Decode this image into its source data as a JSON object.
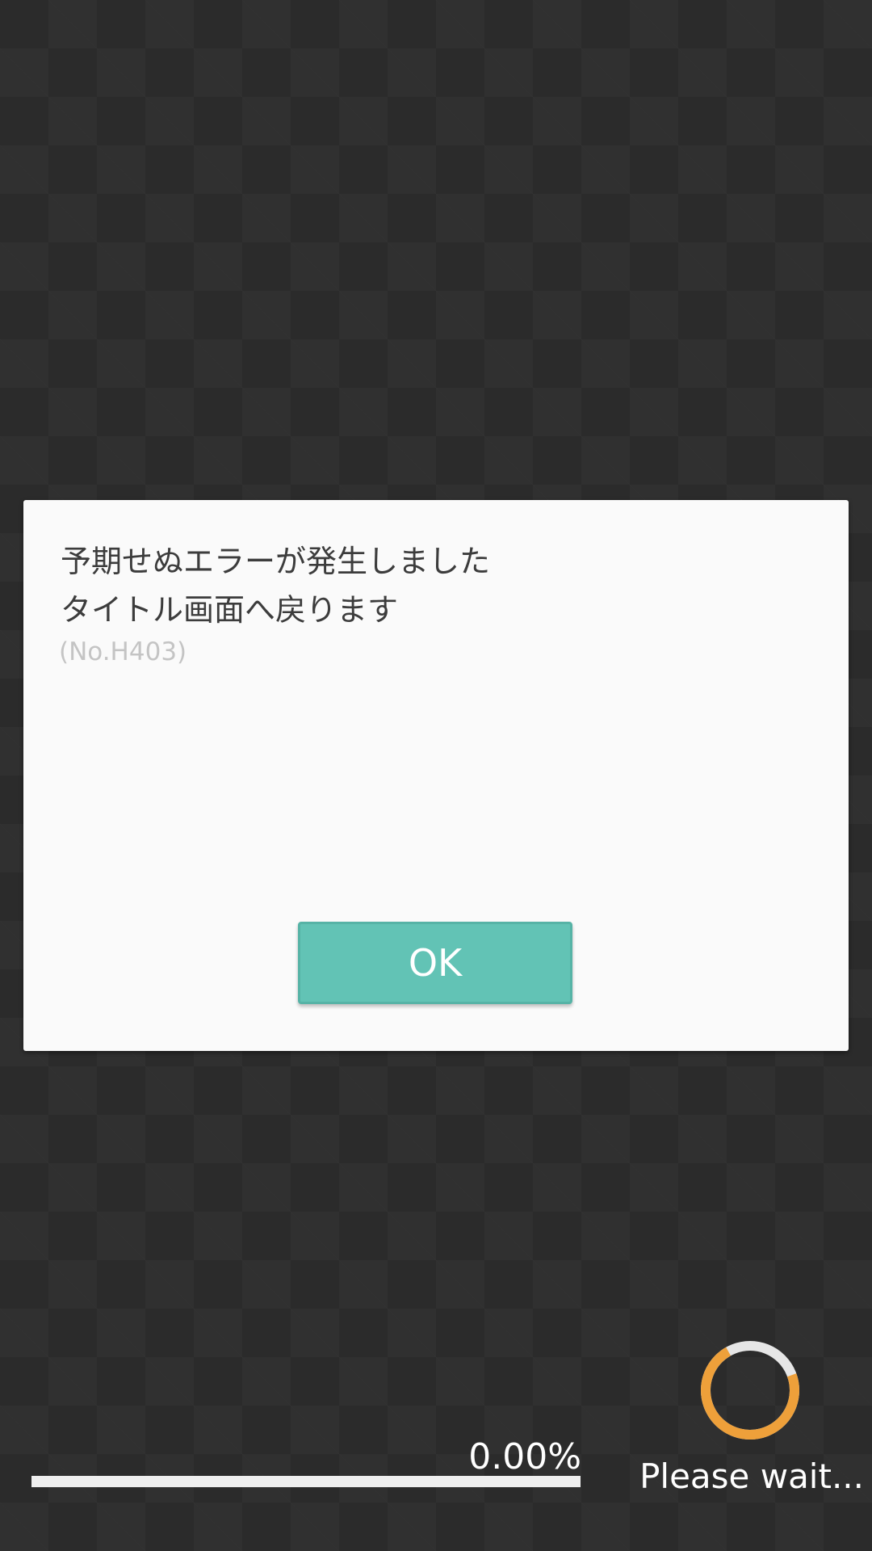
{
  "dialog": {
    "message_line1": "予期せぬエラーが発生しました",
    "message_line2": "タイトル画面へ戻ります",
    "error_code": "(No.H403)",
    "ok_label": "OK"
  },
  "loading": {
    "progress_text": "0.00%",
    "progress_fraction": 0.0,
    "status_text": "Please wait...",
    "spinner_icon": "loading-spinner-icon"
  },
  "colors": {
    "background": "#2b2b2b",
    "dialog_background": "#fafafa",
    "button": "#62c3b5",
    "spinner_accent": "#eea03a",
    "spinner_track": "#e6e6e6"
  }
}
